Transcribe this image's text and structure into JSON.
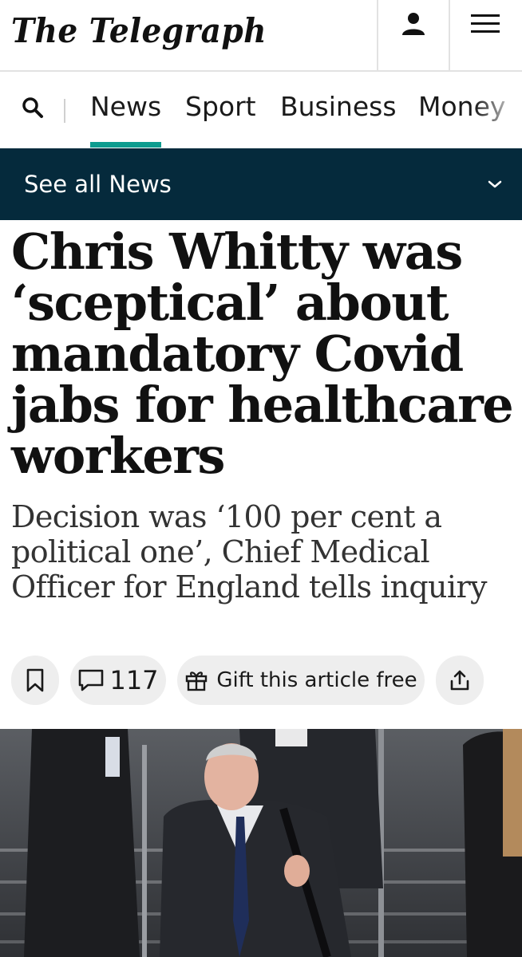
{
  "header": {
    "logo": "The Telegraph",
    "account_icon": "person-icon",
    "menu_icon": "hamburger-menu-icon"
  },
  "nav": {
    "search_icon": "search-icon",
    "tabs": [
      {
        "label": "News",
        "active": true
      },
      {
        "label": "Sport",
        "active": false
      },
      {
        "label": "Business",
        "active": false
      },
      {
        "label": "Money",
        "active": false
      }
    ],
    "accent_color": "#0e9c8f"
  },
  "section_bar": {
    "label": "See all News",
    "background": "#052a3c",
    "icon": "chevron-down-icon"
  },
  "article": {
    "headline": "Chris Whitty was ‘sceptical’ about mandatory Covid jabs for healthcare workers",
    "standfirst": "Decision was ‘100 per cent a political one’, Chief Medical Officer for England tells inquiry",
    "actions": {
      "bookmark_icon": "bookmark-icon",
      "comment_icon": "comment-bubble-icon",
      "comment_count": "117",
      "gift_icon": "gift-icon",
      "gift_label": "Gift this article free",
      "share_icon": "share-icon"
    }
  }
}
